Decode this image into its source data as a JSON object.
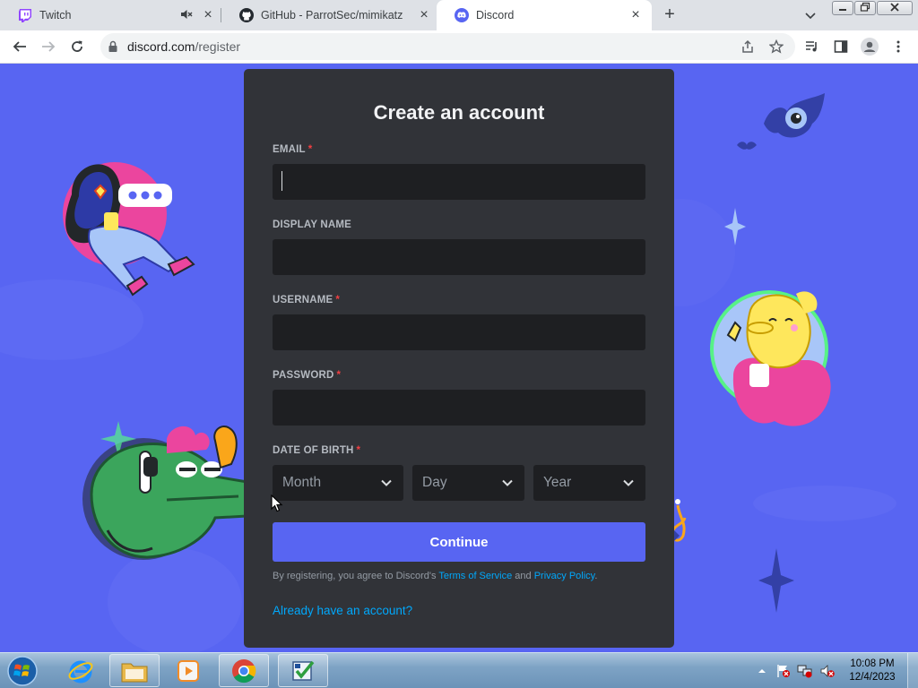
{
  "browser": {
    "tabs": [
      {
        "title": "Twitch",
        "muted": true
      },
      {
        "title": "GitHub - ParrotSec/mimikatz"
      },
      {
        "title": "Discord",
        "active": true
      }
    ],
    "new_tab": "+",
    "url_host": "discord.com",
    "url_path": "/register"
  },
  "form": {
    "title": "Create an account",
    "email_label": "EMAIL",
    "display_name_label": "DISPLAY NAME",
    "username_label": "USERNAME",
    "password_label": "PASSWORD",
    "dob_label": "DATE OF BIRTH",
    "required_mark": "*",
    "month_placeholder": "Month",
    "day_placeholder": "Day",
    "year_placeholder": "Year",
    "continue_label": "Continue",
    "terms_prefix": "By registering, you agree to Discord's ",
    "terms_link": "Terms of Service",
    "terms_and": " and ",
    "privacy_link": "Privacy Policy",
    "terms_suffix": ".",
    "login_link": "Already have an account?"
  },
  "taskbar": {
    "time": "10:08 PM",
    "date": "12/4/2023"
  },
  "colors": {
    "brand": "#5865f2",
    "card": "#313338",
    "input": "#1e1f22",
    "link": "#00a8fc",
    "required": "#f23f42"
  }
}
